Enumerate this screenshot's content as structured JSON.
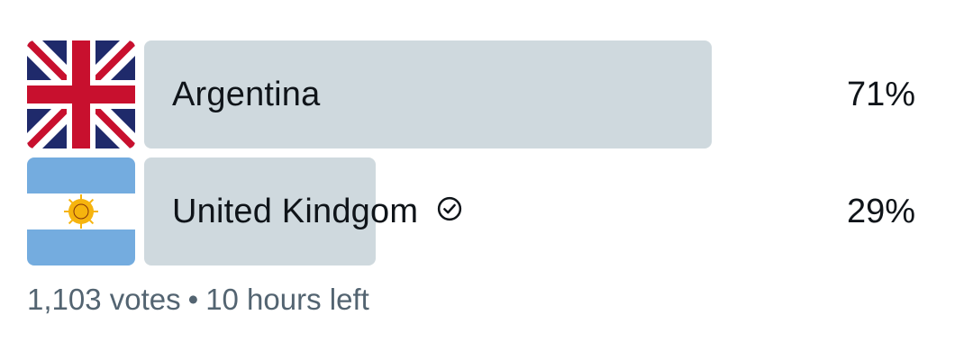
{
  "poll": {
    "options": [
      {
        "label": "Argentina",
        "percent": "71%",
        "share": 0.71,
        "flag_icon": "united-kingdom-flag-icon",
        "selected": false
      },
      {
        "label": "United Kindgom",
        "percent": "29%",
        "share": 0.29,
        "flag_icon": "argentina-flag-icon",
        "selected": true,
        "selected_icon": "check-circle-icon"
      }
    ],
    "votes": "1,103 votes",
    "separator": "•",
    "time_left": "10 hours left"
  },
  "colors": {
    "bar_fill": "#cfd9de",
    "text_primary": "#0f1419",
    "text_secondary": "#536471"
  }
}
